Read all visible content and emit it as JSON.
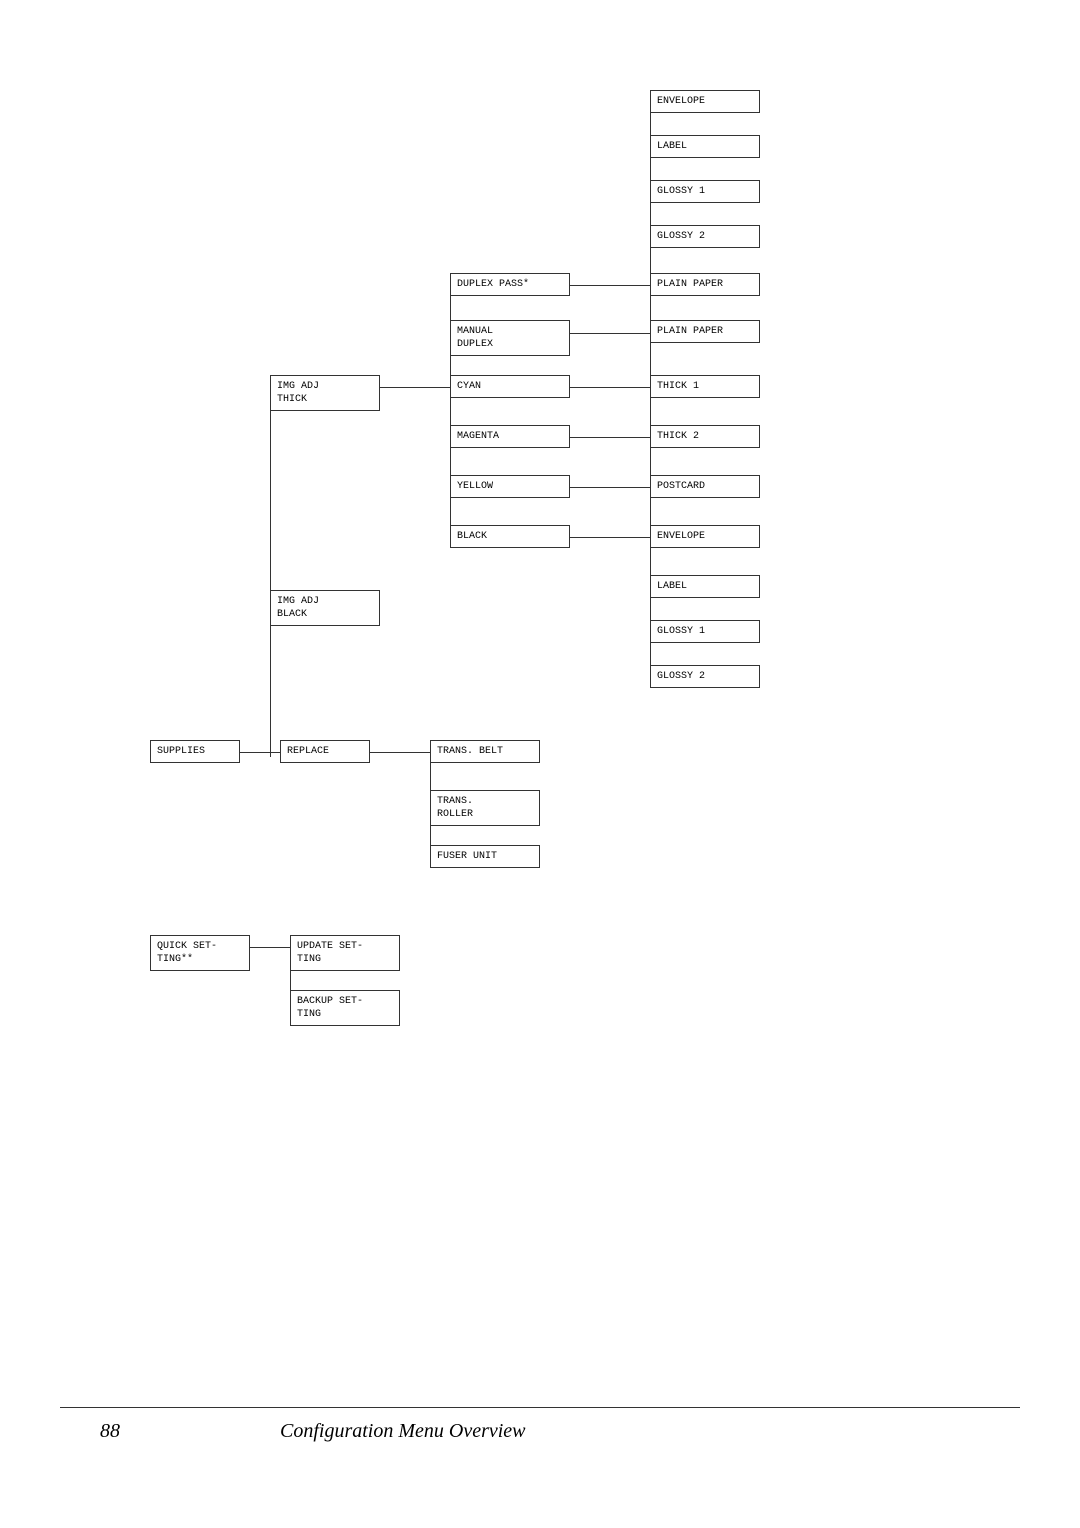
{
  "page": {
    "number": "88",
    "title": "Configuration Menu Overview"
  },
  "nodes": {
    "envelope_top": "ENVELOPE",
    "label_top": "LABEL",
    "glossy1_top": "GLOSSY 1",
    "glossy2_top": "GLOSSY 2",
    "duplex_pass": "DUPLEX PASS*",
    "plain_paper_1": "PLAIN PAPER",
    "manual_duplex": "MANUAL\nDUPLEX",
    "plain_paper_2": "PLAIN PAPER",
    "img_adj_thick": "IMG ADJ\nTHICK",
    "cyan": "CYAN",
    "thick1": "THICK 1",
    "magenta": "MAGENTA",
    "thick2": "THICK 2",
    "yellow": "YELLOW",
    "postcard": "POSTCARD",
    "black": "BLACK",
    "envelope_mid": "ENVELOPE",
    "img_adj_black": "IMG ADJ\nBLACK",
    "label_mid": "LABEL",
    "glossy1_mid": "GLOSSY 1",
    "glossy2_mid": "GLOSSY 2",
    "supplies": "SUPPLIES",
    "replace": "REPLACE",
    "trans_belt": "TRANS. BELT",
    "trans_roller": "TRANS.\nROLLER",
    "fuser_unit": "FUSER UNIT",
    "quick_setting": "QUICK SET-\nTING**",
    "update_setting": "UPDATE SET-\nTING",
    "backup_setting": "BACKUP SET-\nTING"
  }
}
